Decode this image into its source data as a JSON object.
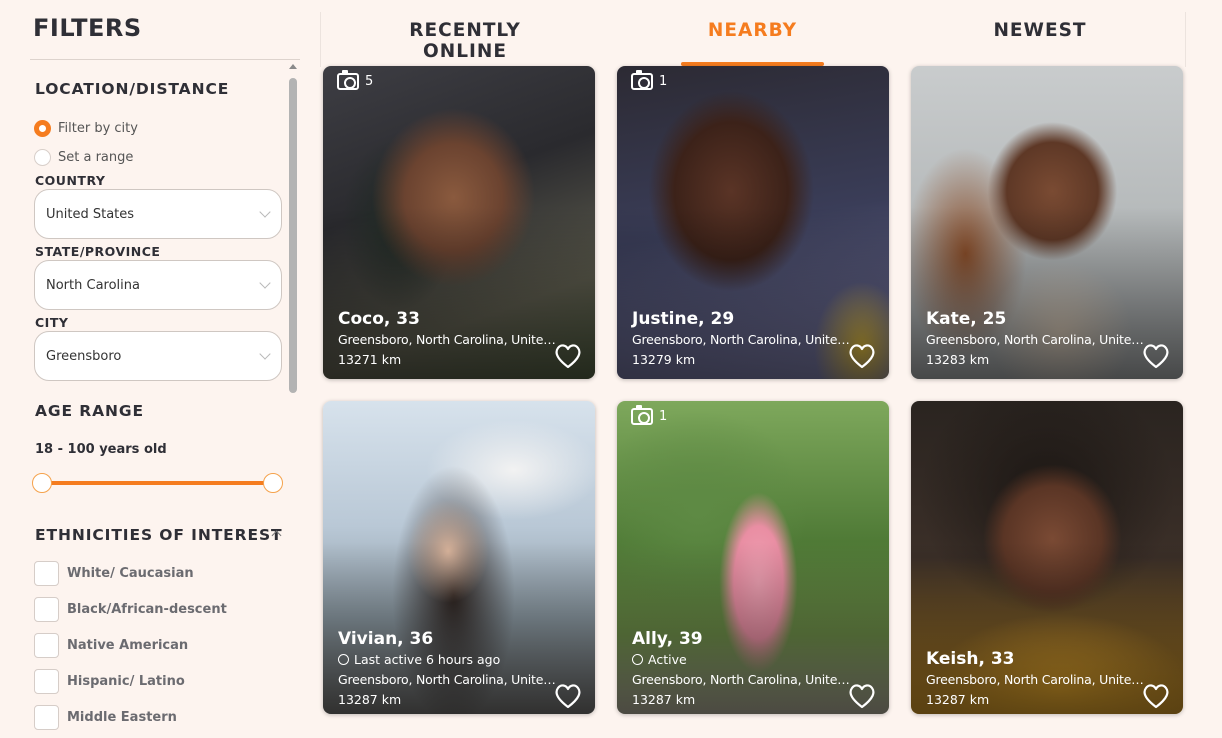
{
  "sidebar": {
    "title": "FILTERS",
    "location": {
      "title": "LOCATION/DISTANCE",
      "options": [
        {
          "label": "Filter by city",
          "checked": true
        },
        {
          "label": "Set a range",
          "checked": false
        }
      ],
      "country_label": "COUNTRY",
      "country_value": "United States",
      "state_label": "STATE/PROVINCE",
      "state_value": "North Carolina",
      "city_label": "CITY",
      "city_value": "Greensboro"
    },
    "age": {
      "title": "AGE RANGE",
      "text": "18 - 100 years old",
      "min": 18,
      "max": 100
    },
    "ethnicities": {
      "title": "ETHNICITIES OF INTEREST",
      "items": [
        "White/ Caucasian",
        "Black/African-descent",
        "Native American",
        "Hispanic/ Latino",
        "Middle Eastern"
      ]
    }
  },
  "tabs": [
    {
      "label": "RECENTLY ONLINE",
      "active": false
    },
    {
      "label": "NEARBY",
      "active": true
    },
    {
      "label": "NEWEST",
      "active": false
    }
  ],
  "colors": {
    "accent": "#f57c1f",
    "background": "#fdf4ef"
  },
  "profiles": [
    {
      "name": "Coco, 33",
      "photos": "5",
      "status": "",
      "location": "Greensboro, North Carolina, United States",
      "distance": "13271 km"
    },
    {
      "name": "Justine, 29",
      "photos": "1",
      "status": "",
      "location": "Greensboro, North Carolina, United States",
      "distance": "13279 km"
    },
    {
      "name": "Kate, 25",
      "photos": "",
      "status": "",
      "location": "Greensboro, North Carolina, United States",
      "distance": "13283 km"
    },
    {
      "name": "Vivian, 36",
      "photos": "",
      "status": "Last active 6 hours ago",
      "location": "Greensboro, North Carolina, United States",
      "distance": "13287 km"
    },
    {
      "name": "Ally, 39",
      "photos": "1",
      "status": "Active",
      "location": "Greensboro, North Carolina, United States",
      "distance": "13287 km"
    },
    {
      "name": "Keish, 33",
      "photos": "",
      "status": "",
      "location": "Greensboro, North Carolina, United States",
      "distance": "13287 km"
    }
  ]
}
